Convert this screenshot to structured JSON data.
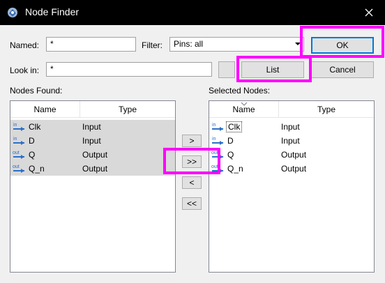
{
  "window": {
    "title": "Node Finder"
  },
  "form": {
    "named_label": "Named:",
    "named_value": "*",
    "filter_label": "Filter:",
    "filter_value": "Pins: all",
    "lookin_label": "Look in:",
    "lookin_value": "*",
    "browse_label": "..."
  },
  "buttons": {
    "ok": "OK",
    "list": "List",
    "cancel": "Cancel",
    "add_one": ">",
    "add_all": ">>",
    "remove_one": "<",
    "remove_all": "<<"
  },
  "nodes_found": {
    "label": "Nodes Found:",
    "columns": [
      "Name",
      "Type"
    ],
    "rows": [
      {
        "pin": "in",
        "name": "Clk",
        "type": "Input"
      },
      {
        "pin": "in",
        "name": "D",
        "type": "Input"
      },
      {
        "pin": "out",
        "name": "Q",
        "type": "Output"
      },
      {
        "pin": "out",
        "name": "Q_n",
        "type": "Output"
      }
    ]
  },
  "selected_nodes": {
    "label": "Selected Nodes:",
    "columns": [
      "Name",
      "Type"
    ],
    "rows": [
      {
        "pin": "in",
        "name": "Clk",
        "type": "Input"
      },
      {
        "pin": "in",
        "name": "D",
        "type": "Input"
      },
      {
        "pin": "out",
        "name": "Q",
        "type": "Output"
      },
      {
        "pin": "out",
        "name": "Q_n",
        "type": "Output"
      }
    ]
  },
  "colors": {
    "highlight": "#ff00ff",
    "title_bar": "#000000",
    "default_button_border": "#0078d7",
    "pin_icon": "#2a6fc9"
  }
}
